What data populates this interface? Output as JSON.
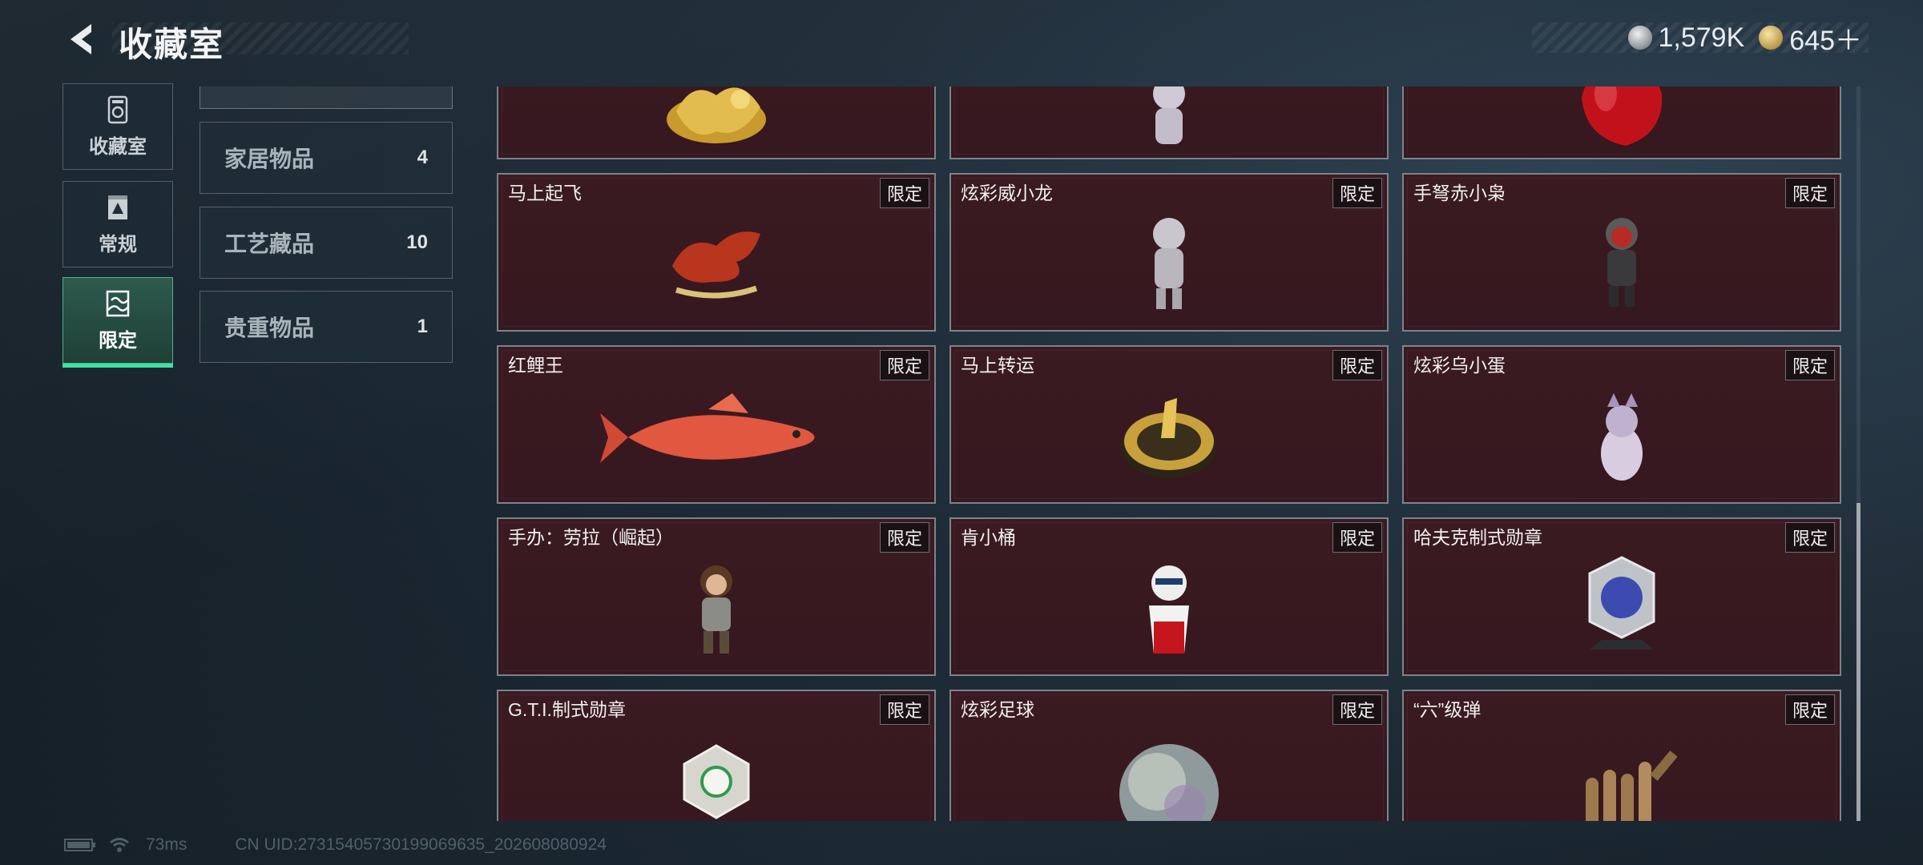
{
  "header": {
    "title": "收藏室",
    "currency_silver": "1,579K",
    "currency_gold": "645＋"
  },
  "nav": [
    {
      "label": "收藏室",
      "icon": "collection-room-icon"
    },
    {
      "label": "常规",
      "icon": "regular-icon"
    },
    {
      "label": "限定",
      "icon": "limited-icon",
      "active": true
    }
  ],
  "subcategories": [
    {
      "name": "家居物品",
      "count": "4"
    },
    {
      "name": "工艺藏品",
      "count": "10"
    },
    {
      "name": "贵重物品",
      "count": "1"
    }
  ],
  "items": [
    {
      "name": "",
      "badge": "",
      "art": "golden-dragon"
    },
    {
      "name": "",
      "badge": "",
      "art": "white-figure"
    },
    {
      "name": "",
      "badge": "",
      "art": "red-apple"
    },
    {
      "name": "马上起飞",
      "badge": "限定",
      "art": "red-horse"
    },
    {
      "name": "炫彩威小龙",
      "badge": "限定",
      "art": "silver-dragon-figure"
    },
    {
      "name": "手弩赤小枭",
      "badge": "限定",
      "art": "hooded-figure"
    },
    {
      "name": "红鲤王",
      "badge": "限定",
      "art": "red-carp"
    },
    {
      "name": "马上转运",
      "badge": "限定",
      "art": "gold-horse-disc"
    },
    {
      "name": "炫彩乌小蛋",
      "badge": "限定",
      "art": "egg-figure"
    },
    {
      "name": "手办：劳拉（崛起）",
      "badge": "限定",
      "art": "lara-figure"
    },
    {
      "name": "肯小桶",
      "badge": "限定",
      "art": "colonel-figure"
    },
    {
      "name": "哈夫克制式勋章",
      "badge": "限定",
      "art": "haavk-medal"
    },
    {
      "name": "G.T.I.制式勋章",
      "badge": "限定",
      "art": "gti-medal"
    },
    {
      "name": "炫彩足球",
      "badge": "限定",
      "art": "iridescent-ball"
    },
    {
      "name": "“六”级弹",
      "badge": "限定",
      "art": "bullet-hand"
    }
  ],
  "status": {
    "ping": "73ms",
    "uid": "CN UID:27315405730199069635_202608080924"
  },
  "colors": {
    "accent": "#3fe0a4",
    "card_bg": "#3b1a21"
  }
}
